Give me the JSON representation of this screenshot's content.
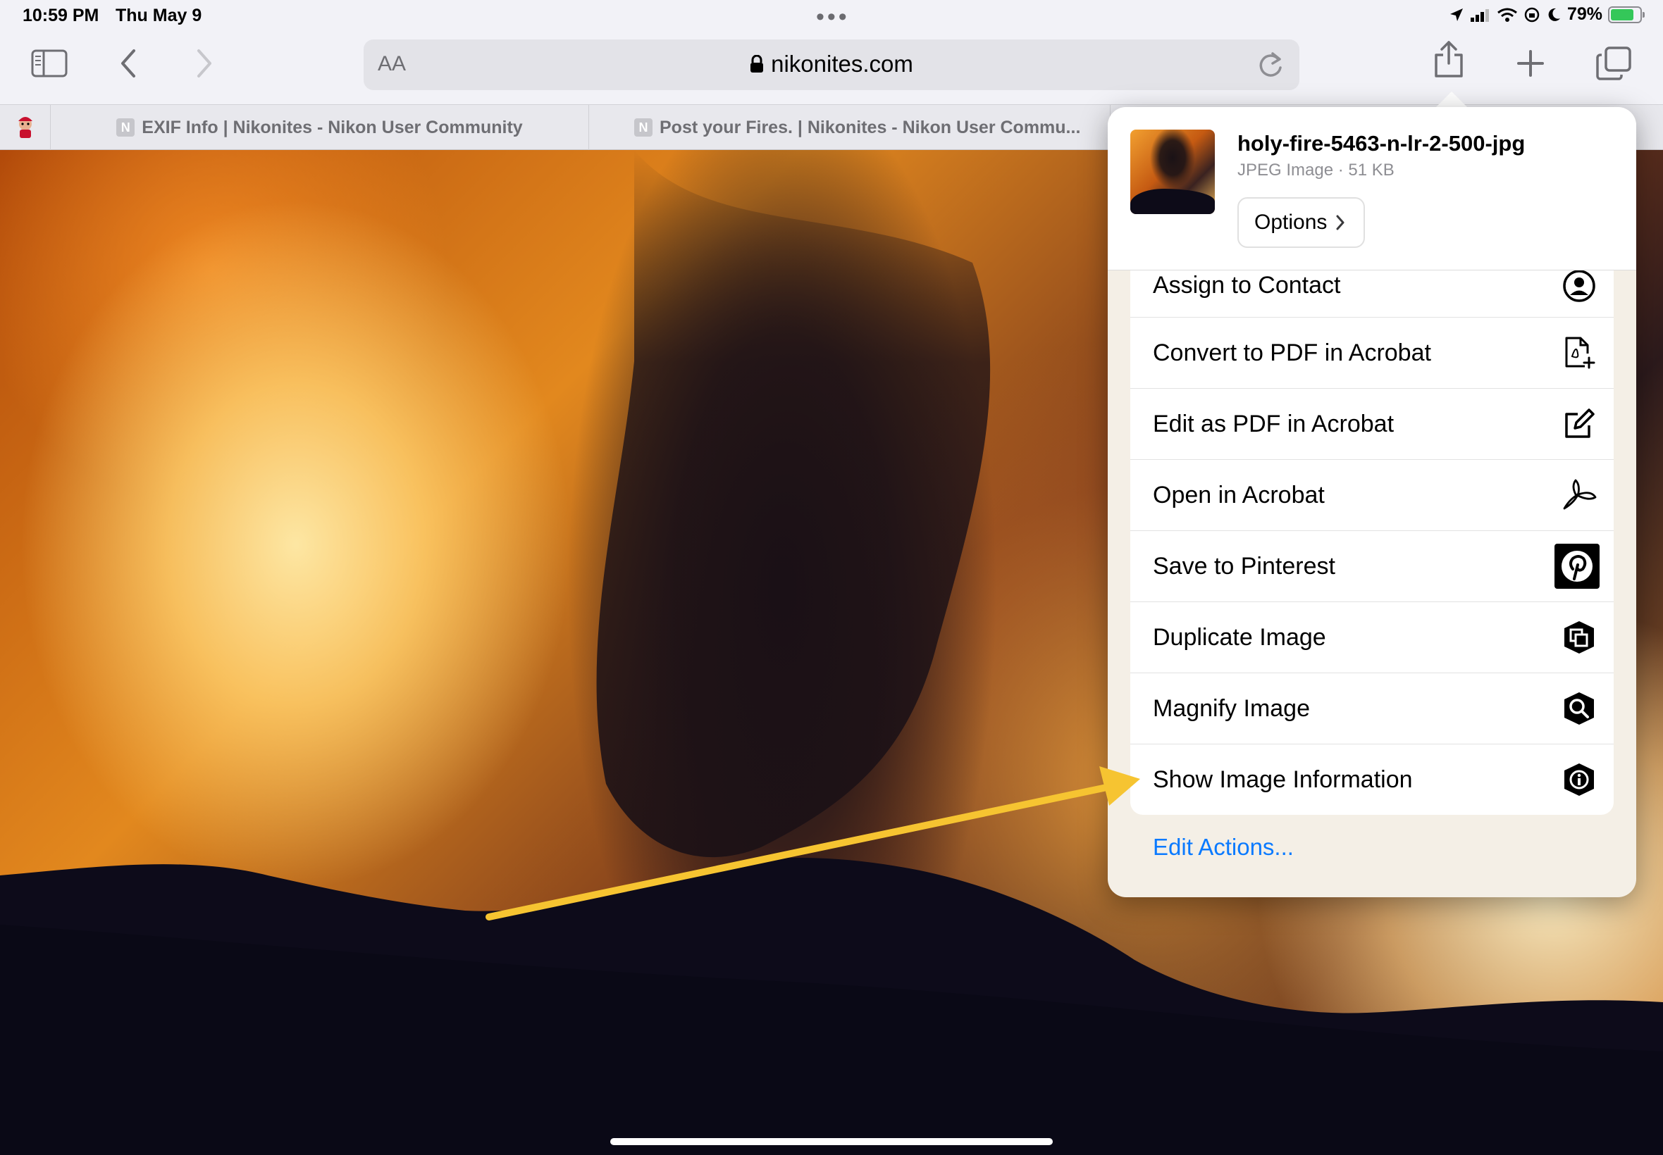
{
  "status_bar": {
    "time": "10:59 PM",
    "date": "Thu May 9",
    "battery_percent": "79%",
    "battery_level": 0.79
  },
  "toolbar": {
    "text_size_label": "AA",
    "domain": "nikonites.com"
  },
  "tabs": [
    {
      "favicon": "N",
      "title": "EXIF Info | Nikonites - Nikon User Community"
    },
    {
      "favicon": "N",
      "title": "Post your Fires. | Nikonites - Nikon User Commu..."
    }
  ],
  "share_sheet": {
    "file_name": "holy-fire-5463-n-lr-2-500-jpg",
    "file_meta": "JPEG Image · 51 KB",
    "options_label": "Options",
    "actions": [
      {
        "label": "Assign to Contact",
        "icon": "person-circle-icon"
      },
      {
        "label": "Convert to PDF in Acrobat",
        "icon": "pdf-add-icon"
      },
      {
        "label": "Edit as PDF in Acrobat",
        "icon": "edit-square-icon"
      },
      {
        "label": "Open in Acrobat",
        "icon": "acrobat-icon"
      },
      {
        "label": "Save to Pinterest",
        "icon": "pinterest-icon"
      },
      {
        "label": "Duplicate Image",
        "icon": "duplicate-layers-icon"
      },
      {
        "label": "Magnify Image",
        "icon": "magnify-layers-icon"
      },
      {
        "label": "Show Image Information",
        "icon": "info-layers-icon"
      }
    ],
    "edit_actions_label": "Edit Actions..."
  },
  "colors": {
    "accent_blue": "#0a7aff",
    "arrow_yellow": "#f6c431",
    "battery_green": "#34c759"
  }
}
